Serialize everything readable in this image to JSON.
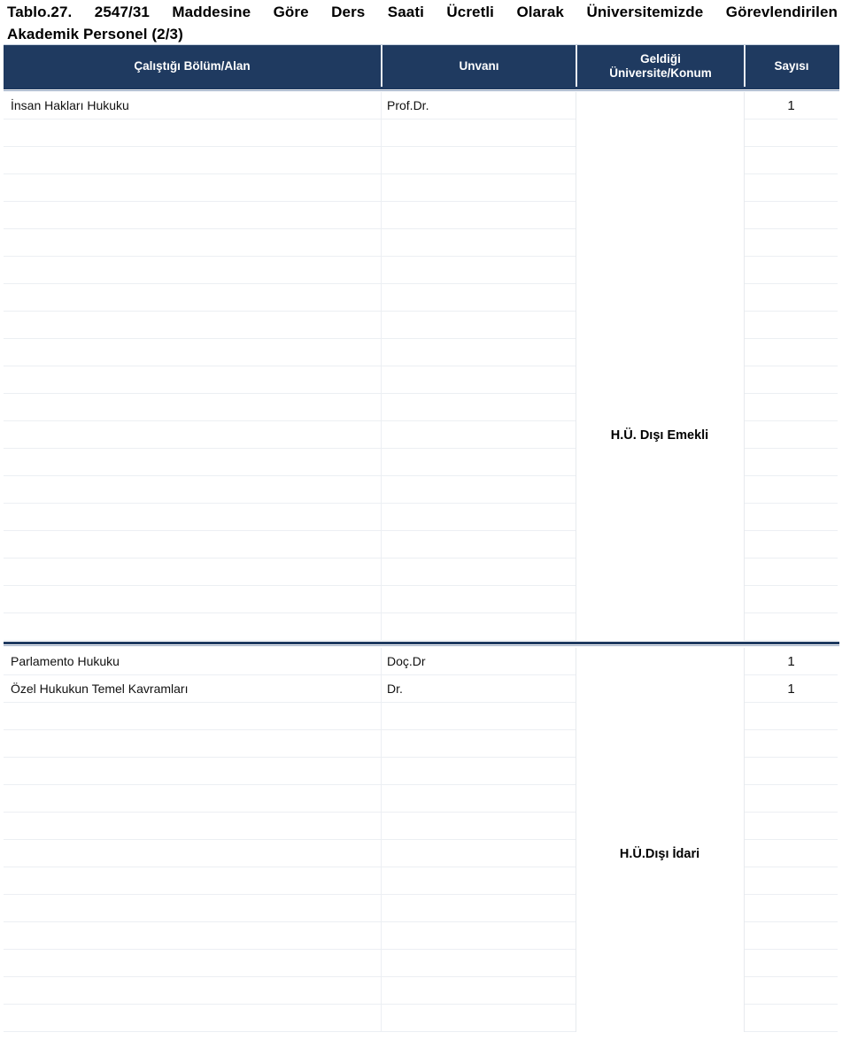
{
  "title": {
    "line1_words": [
      "Tablo.27.",
      "2547/31",
      "Maddesine",
      "Göre",
      "Ders",
      "Saati",
      "Ücretli",
      "Olarak",
      "Üniversitemizde",
      "Görevlendirilen"
    ],
    "line2": "Akademik Personel   (2/3)",
    "full": "Tablo.27. 2547/31 Maddesine Göre Ders Saati Ücretli Olarak Üniversitemizde Görevlendirilen Akademik Personel (2/3)"
  },
  "colors": {
    "header_bg": "#1f3a60",
    "header_text": "#ffffff",
    "grid_line": "#eceff3",
    "rule": "#1f3a60"
  },
  "table": {
    "headers": [
      {
        "label": "Çalıştığı Bölüm/Alan"
      },
      {
        "label": "Unvanı"
      },
      {
        "label": "Geldiği\nÜniversite/Konum",
        "line1": "Geldiği",
        "line2": "Üniversite/Konum"
      },
      {
        "label": "Sayısı"
      }
    ],
    "sections": [
      {
        "group_label": "H.Ü. Dışı Emekli",
        "group_label_row": 12,
        "rows": [
          {
            "bolum": "İnsan Hakları Hukuku",
            "unvan": "Prof.Dr.",
            "sayi": "1"
          },
          {
            "bolum": "",
            "unvan": "",
            "sayi": ""
          },
          {
            "bolum": "",
            "unvan": "",
            "sayi": ""
          },
          {
            "bolum": "",
            "unvan": "",
            "sayi": ""
          },
          {
            "bolum": "",
            "unvan": "",
            "sayi": ""
          },
          {
            "bolum": "",
            "unvan": "",
            "sayi": ""
          },
          {
            "bolum": "",
            "unvan": "",
            "sayi": ""
          },
          {
            "bolum": "",
            "unvan": "",
            "sayi": ""
          },
          {
            "bolum": "",
            "unvan": "",
            "sayi": ""
          },
          {
            "bolum": "",
            "unvan": "",
            "sayi": ""
          },
          {
            "bolum": "",
            "unvan": "",
            "sayi": ""
          },
          {
            "bolum": "",
            "unvan": "",
            "sayi": ""
          },
          {
            "bolum": "",
            "unvan": "",
            "sayi": ""
          },
          {
            "bolum": "",
            "unvan": "",
            "sayi": ""
          },
          {
            "bolum": "",
            "unvan": "",
            "sayi": ""
          },
          {
            "bolum": "",
            "unvan": "",
            "sayi": ""
          },
          {
            "bolum": "",
            "unvan": "",
            "sayi": ""
          },
          {
            "bolum": "",
            "unvan": "",
            "sayi": ""
          },
          {
            "bolum": "",
            "unvan": "",
            "sayi": ""
          },
          {
            "bolum": "",
            "unvan": "",
            "sayi": ""
          }
        ]
      },
      {
        "group_label": "H.Ü.Dışı İdari",
        "group_label_row": 7,
        "rows": [
          {
            "bolum": "Parlamento Hukuku",
            "unvan": "Doç.Dr",
            "sayi": "1"
          },
          {
            "bolum": "Özel Hukukun Temel Kavramları",
            "unvan": "Dr.",
            "sayi": "1"
          },
          {
            "bolum": "",
            "unvan": "",
            "sayi": ""
          },
          {
            "bolum": "",
            "unvan": "",
            "sayi": ""
          },
          {
            "bolum": "",
            "unvan": "",
            "sayi": ""
          },
          {
            "bolum": "",
            "unvan": "",
            "sayi": ""
          },
          {
            "bolum": "",
            "unvan": "",
            "sayi": ""
          },
          {
            "bolum": "",
            "unvan": "",
            "sayi": ""
          },
          {
            "bolum": "",
            "unvan": "",
            "sayi": ""
          },
          {
            "bolum": "",
            "unvan": "",
            "sayi": ""
          },
          {
            "bolum": "",
            "unvan": "",
            "sayi": ""
          },
          {
            "bolum": "",
            "unvan": "",
            "sayi": ""
          },
          {
            "bolum": "",
            "unvan": "",
            "sayi": ""
          },
          {
            "bolum": "",
            "unvan": "",
            "sayi": ""
          }
        ]
      }
    ]
  }
}
